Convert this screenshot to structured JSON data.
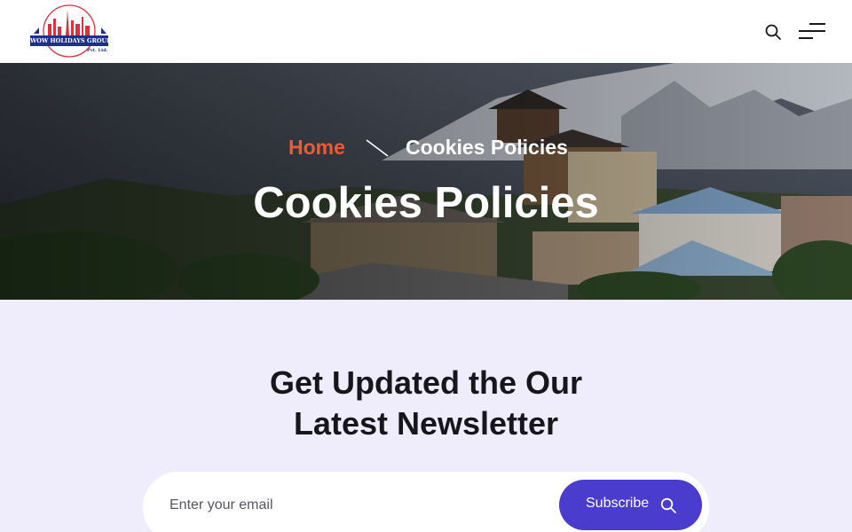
{
  "header": {
    "logo": {
      "text": "WOW HOLIDAYS GROUP",
      "sub": "Pvt. Ltd."
    },
    "search_icon": "search-icon",
    "menu_icon": "hamburger-menu-icon"
  },
  "hero": {
    "breadcrumb": {
      "home": "Home",
      "separator_icon": "slash-separator-icon",
      "current": "Cookies Policies"
    },
    "title": "Cookies Policies"
  },
  "newsletter": {
    "title_line1": "Get Updated the Our",
    "title_line2": "Latest Newsletter",
    "email_placeholder": "Enter your email",
    "email_value": "",
    "subscribe_label": "Subscribe",
    "subscribe_icon": "search-icon"
  },
  "colors": {
    "accent": "#4a3ccc",
    "breadcrumb_home": "#ee5a36",
    "section_bg": "#efedfb"
  }
}
